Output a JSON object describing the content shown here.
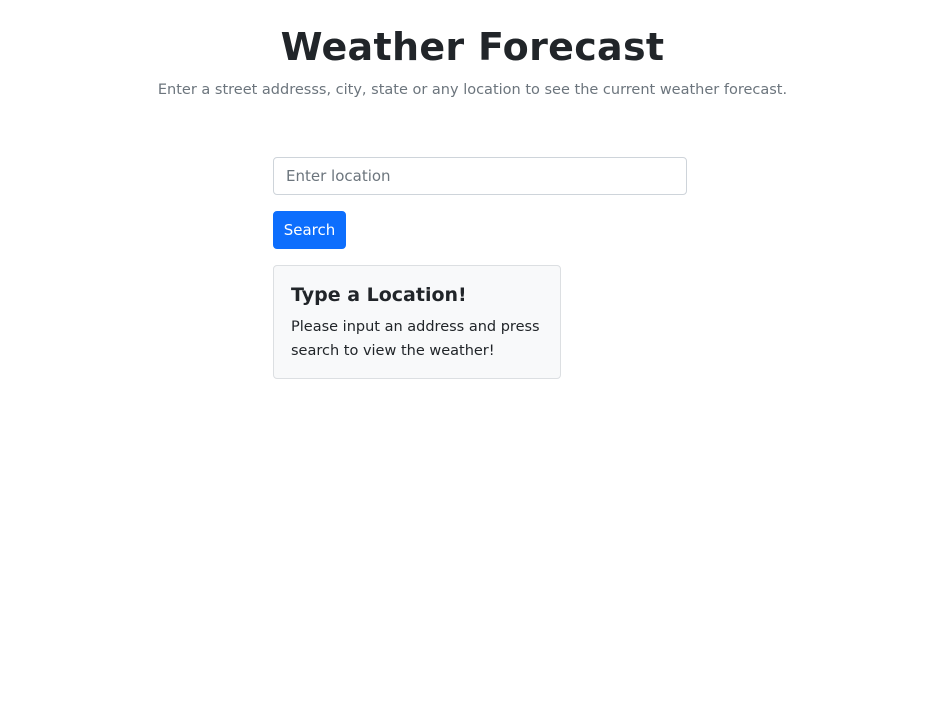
{
  "header": {
    "title": "Weather Forecast",
    "subtitle": "Enter a street addresss, city, state or any location to see the current weather forecast."
  },
  "search": {
    "value": "",
    "placeholder": "Enter location",
    "button_label": "Search"
  },
  "card": {
    "title": "Type a Location!",
    "text": "Please input an address and press search to view the weather!"
  },
  "colors": {
    "primary": "#0d6efd",
    "text": "#212529",
    "muted": "#6c757d",
    "card_background": "#f8f9fa",
    "border": "#ced4da"
  }
}
